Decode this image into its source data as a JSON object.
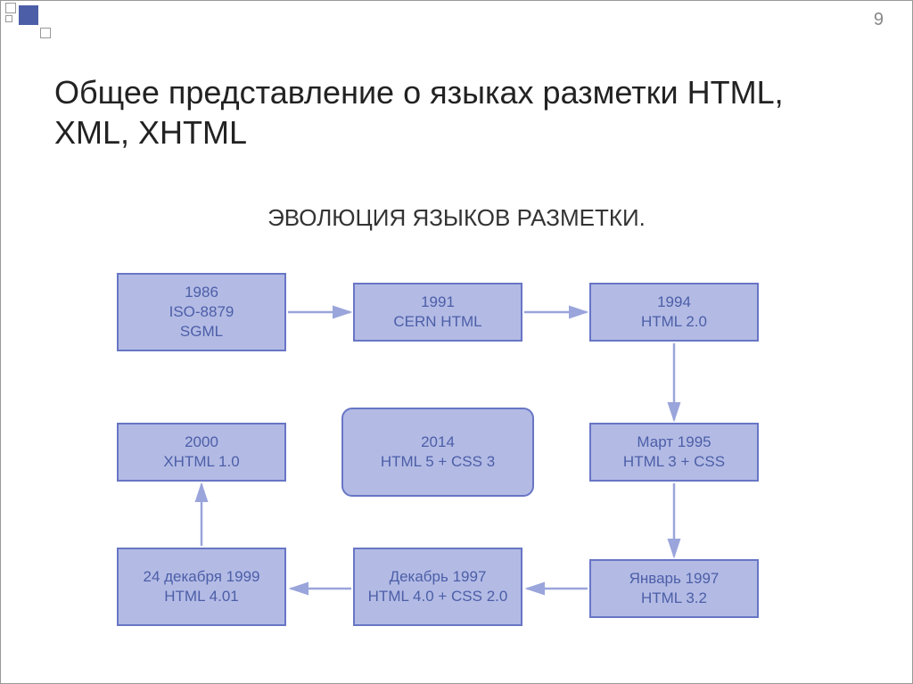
{
  "page_number": "9",
  "title": "Общее представление о языках разметки HTML, XML, XHTML",
  "subtitle": "ЭВОЛЮЦИЯ ЯЗЫКОВ РАЗМЕТКИ.",
  "boxes": {
    "sgml": "1986\nISO-8879\nSGML",
    "cern": "1991\nCERN HTML",
    "html20": "1994\nHTML 2.0",
    "xhtml": "2000\nXHTML 1.0",
    "html5": "2014\nHTML 5 + CSS 3",
    "html3": "Март 1995\nHTML 3 +   CSS",
    "html401": "24 декабря 1999\nHTML 4.01",
    "html40": "Декабрь 1997\nHTML 4.0 + CSS 2.0",
    "html32": "Январь 1997\nHTML 3.2"
  },
  "chart_data": {
    "type": "flowchart",
    "title": "ЭВОЛЮЦИЯ ЯЗЫКОВ РАЗМЕТКИ",
    "nodes": [
      {
        "id": "sgml",
        "label": "1986 ISO-8879 SGML",
        "year": 1986
      },
      {
        "id": "cern",
        "label": "1991 CERN HTML",
        "year": 1991
      },
      {
        "id": "html20",
        "label": "1994 HTML 2.0",
        "year": 1994
      },
      {
        "id": "html3",
        "label": "Март 1995 HTML 3 + CSS",
        "year": 1995
      },
      {
        "id": "html32",
        "label": "Январь 1997 HTML 3.2",
        "year": 1997
      },
      {
        "id": "html40",
        "label": "Декабрь 1997 HTML 4.0 + CSS 2.0",
        "year": 1997
      },
      {
        "id": "html401",
        "label": "24 декабря 1999 HTML 4.01",
        "year": 1999
      },
      {
        "id": "xhtml",
        "label": "2000 XHTML 1.0",
        "year": 2000
      },
      {
        "id": "html5",
        "label": "2014 HTML 5 + CSS 3",
        "year": 2014,
        "highlight": true
      }
    ],
    "edges": [
      {
        "from": "sgml",
        "to": "cern"
      },
      {
        "from": "cern",
        "to": "html20"
      },
      {
        "from": "html20",
        "to": "html3"
      },
      {
        "from": "html3",
        "to": "html32"
      },
      {
        "from": "html32",
        "to": "html40"
      },
      {
        "from": "html40",
        "to": "html401"
      },
      {
        "from": "html401",
        "to": "xhtml"
      }
    ]
  }
}
